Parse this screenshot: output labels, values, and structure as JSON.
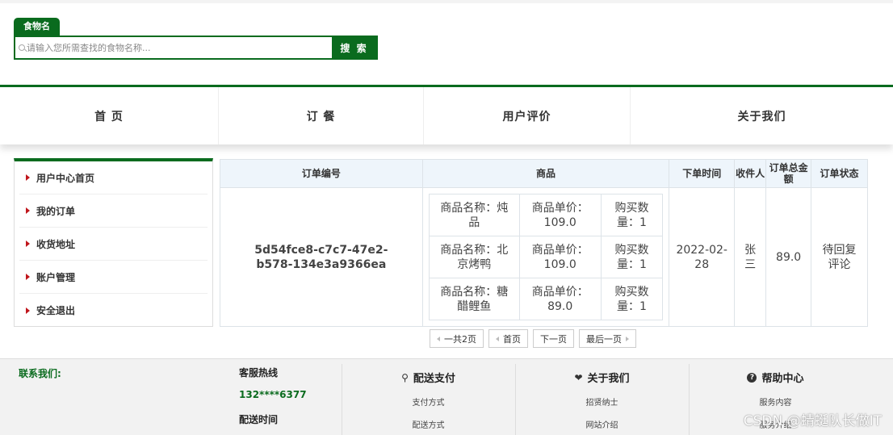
{
  "search": {
    "tab_label": "食物名",
    "placeholder": "请输入您所需查找的食物名称...",
    "button_label": "搜 索"
  },
  "nav": {
    "items": [
      {
        "label": "首 页"
      },
      {
        "label": "订 餐"
      },
      {
        "label": "用户评价"
      },
      {
        "label": "关于我们"
      }
    ]
  },
  "sidebar": {
    "items": [
      {
        "label": "用户中心首页"
      },
      {
        "label": "我的订单"
      },
      {
        "label": "收货地址"
      },
      {
        "label": "账户管理"
      },
      {
        "label": "安全退出"
      }
    ]
  },
  "orders": {
    "headers": {
      "order_no": "订单编号",
      "goods": "商品",
      "order_time": "下单时间",
      "receiver": "收件人",
      "total": "订单总金额",
      "status": "订单状态"
    },
    "rows": [
      {
        "order_no": "5d54fce8-c7c7-47e2-b578-134e3a9366ea",
        "goods": [
          {
            "name": "商品名称：炖品",
            "price": "商品单价：109.0",
            "qty": "购买数量：1"
          },
          {
            "name": "商品名称：北京烤鸭",
            "price": "商品单价：109.0",
            "qty": "购买数量：1"
          },
          {
            "name": "商品名称：糖醋鲤鱼",
            "price": "商品单价：89.0",
            "qty": "购买数量：1"
          }
        ],
        "order_time": "2022-02-28",
        "receiver": "张三",
        "total": "89.0",
        "status": "待回复评论"
      }
    ]
  },
  "pager": {
    "total": "一共2页",
    "first": "首页",
    "next": "下一页",
    "last": "最后一页"
  },
  "footer": {
    "contact_title": "联系我们:",
    "hotline_label": "客服热线",
    "phone": "132****6377",
    "delivery_time_label": "配送时间",
    "columns": [
      {
        "title": "配送支付",
        "icon": "bike-icon",
        "links": [
          "支付方式",
          "配送方式"
        ]
      },
      {
        "title": "关于我们",
        "icon": "heart-icon",
        "links": [
          "招贤纳士",
          "网站介绍"
        ]
      },
      {
        "title": "帮助中心",
        "icon": "question-icon",
        "links": [
          "服务内容",
          "服务介绍"
        ]
      }
    ],
    "watermark": "CSDN @蜻蜓队长做IT"
  },
  "colors": {
    "brand_green": "#0a6b1e",
    "arrow_red": "#c0161c",
    "header_bg": "#eef5fb"
  }
}
